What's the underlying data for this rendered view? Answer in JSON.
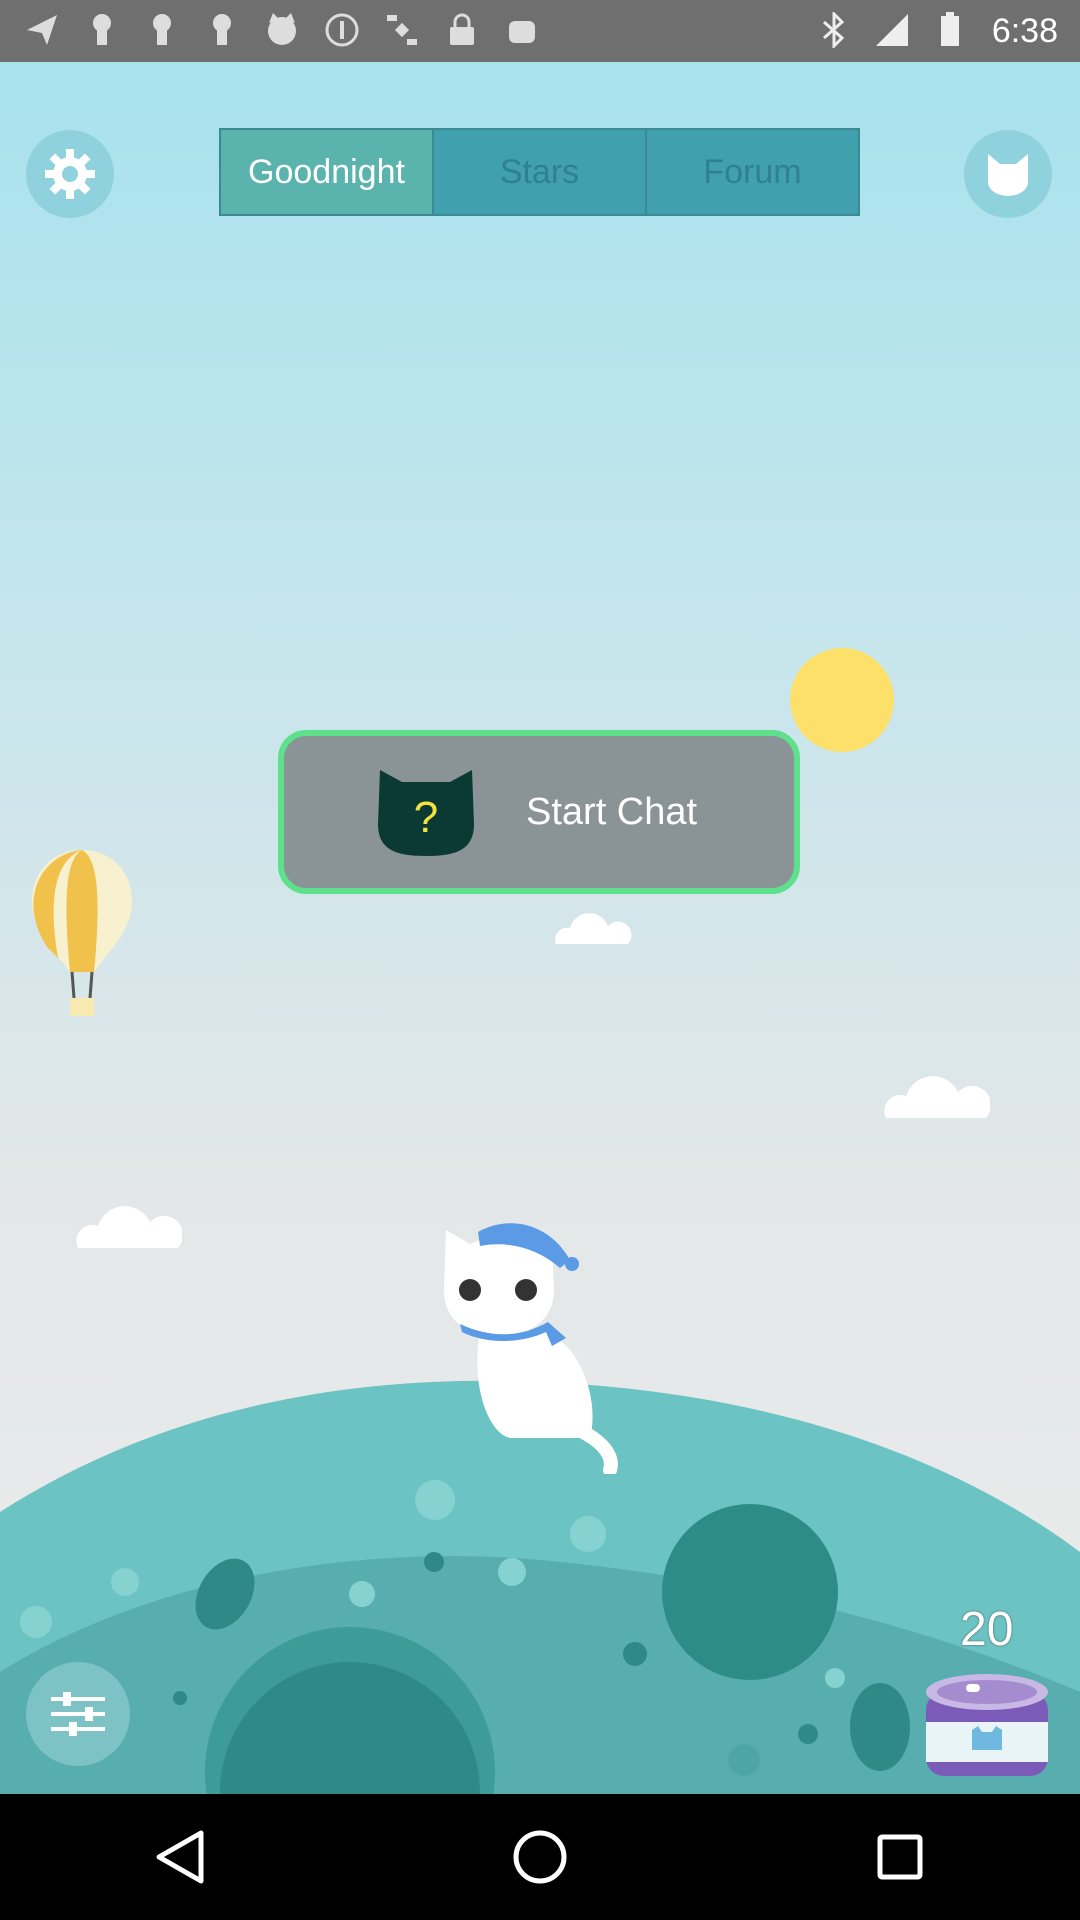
{
  "status_bar": {
    "time": "6:38"
  },
  "tabs": [
    {
      "label": "Goodnight"
    },
    {
      "label": "Stars"
    },
    {
      "label": "Forum"
    }
  ],
  "chat": {
    "label": "Start Chat",
    "icon_text": "?"
  },
  "food": {
    "count": "20"
  },
  "colors": {
    "tab_active": "#5bb3ad",
    "tab_inactive": "#40a0ae",
    "accent_green": "#5ee08d",
    "sun": "#fde06a"
  }
}
